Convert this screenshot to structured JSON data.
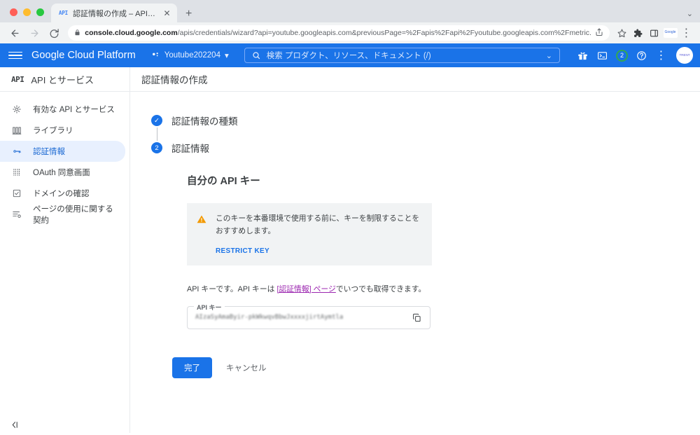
{
  "browser": {
    "tab": {
      "favicon_label": "API",
      "title": "認証情報の作成 – API とサービス",
      "close_label": "✕"
    },
    "new_tab_label": "+",
    "tabstrip_chevron": "⌄",
    "nav": {
      "back": "←",
      "forward": "→",
      "reload": "⟳"
    },
    "omnibox": {
      "lock_icon": "🔒",
      "url_domain": "console.cloud.google.com",
      "url_path": "/apis/credentials/wizard?api=youtube.googleapis.com&previousPage=%2Fapis%2Fapi%2Fyoutube.googleapis.com%2Fmetric...",
      "share_icon": "↥",
      "star_icon": "☆"
    },
    "toolbar_icons": {
      "extensions": "🧩",
      "side_panel": "▯",
      "profile_initials": "Google",
      "menu": "⋮"
    }
  },
  "gcp_header": {
    "menu_label": "ナビゲーション メニュー",
    "logo": "Google Cloud Platform",
    "project_name": "Youtube202204",
    "project_caret": "▾",
    "search": {
      "label": "検索",
      "placeholder": "検索  プロダクト、リソース、ドキュメント (/)",
      "caret": "⌄"
    },
    "icons": {
      "apps": "gift-icon",
      "cloud_shell": "cloud-shell-icon",
      "notifications_count": "2",
      "help": "?",
      "more": "⋮",
      "avatar_initials": "TRENT"
    }
  },
  "sidebar": {
    "header": {
      "glyph": "API",
      "title": "API とサービス"
    },
    "items": [
      {
        "label": "有効な API とサービス",
        "icon": "dashboard-icon",
        "active": false
      },
      {
        "label": "ライブラリ",
        "icon": "library-icon",
        "active": false
      },
      {
        "label": "認証情報",
        "icon": "key-icon",
        "active": true
      },
      {
        "label": "OAuth 同意画面",
        "icon": "consent-icon",
        "active": false
      },
      {
        "label": "ドメインの確認",
        "icon": "domain-verify-icon",
        "active": false
      },
      {
        "label": "ページの使用に関する契約",
        "icon": "agreement-icon",
        "active": false
      }
    ],
    "collapse_label": "◁|"
  },
  "main": {
    "page_title": "認証情報の作成",
    "steps": [
      {
        "mark": "✓",
        "label": "認証情報の種類",
        "state": "completed"
      },
      {
        "mark": "2",
        "label": "認証情報",
        "state": "current"
      }
    ],
    "panel_title": "自分の API キー",
    "warning": {
      "icon": "warning-triangle-icon",
      "text": "このキーを本番環境で使用する前に、キーを制限することをおすすめします。",
      "action_label": "RESTRICT KEY"
    },
    "description": {
      "prefix": "API キーです。API キーは ",
      "link_text": "[認証情報] ページ",
      "suffix": "でいつでも取得できます。"
    },
    "api_key_field": {
      "label": "API キー",
      "value": "AIzaSyAmaByir-pkWkwqvBbwJxxxxjirtAymtla",
      "copy_icon": "copy-icon"
    },
    "buttons": {
      "primary": "完了",
      "secondary": "キャンセル"
    }
  },
  "colors": {
    "gcp_blue": "#1a73e8",
    "warning_orange": "#f29900",
    "link_purple": "#9c27b0",
    "notification_green": "#34a853"
  }
}
